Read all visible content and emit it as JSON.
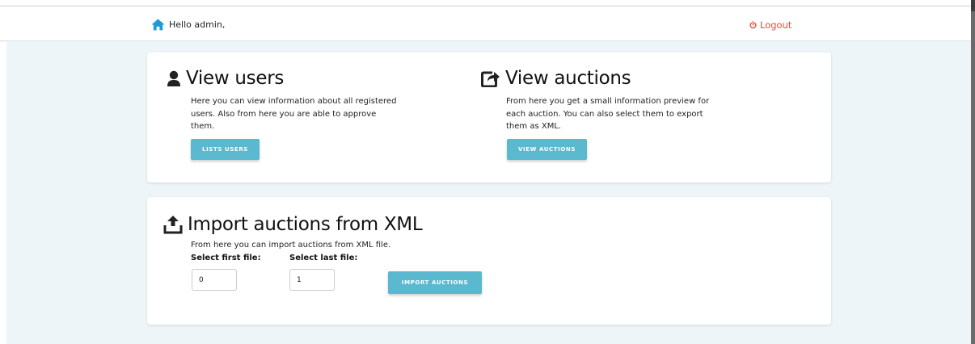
{
  "header": {
    "greeting": "Hello admin,",
    "logout_label": "Logout",
    "home_icon": "home-icon",
    "logout_icon": "power-icon"
  },
  "users_section": {
    "title": "View users",
    "icon": "user-icon",
    "description": "Here you can view information about all registered users. Also from here you are able to approve them.",
    "button_label": "LISTS USERS"
  },
  "auctions_section": {
    "title": "View auctions",
    "icon": "share-icon",
    "description": "From here you get a small information preview for each auction. You can also select them to export them as XML.",
    "button_label": "VIEW AUCTIONS"
  },
  "import_section": {
    "title": "Import auctions from XML",
    "icon": "upload-icon",
    "description": "From here you can import auctions from XML file.",
    "first_file_label": "Select first file:",
    "first_file_value": "0",
    "last_file_label": "Select last file:",
    "last_file_value": "1",
    "button_label": "IMPORT AUCTIONS"
  },
  "colors": {
    "accent_button": "#5bb9cf",
    "logout": "#e74c3c",
    "home_icon": "#1e9bd7",
    "page_background": "#eef5f8"
  }
}
